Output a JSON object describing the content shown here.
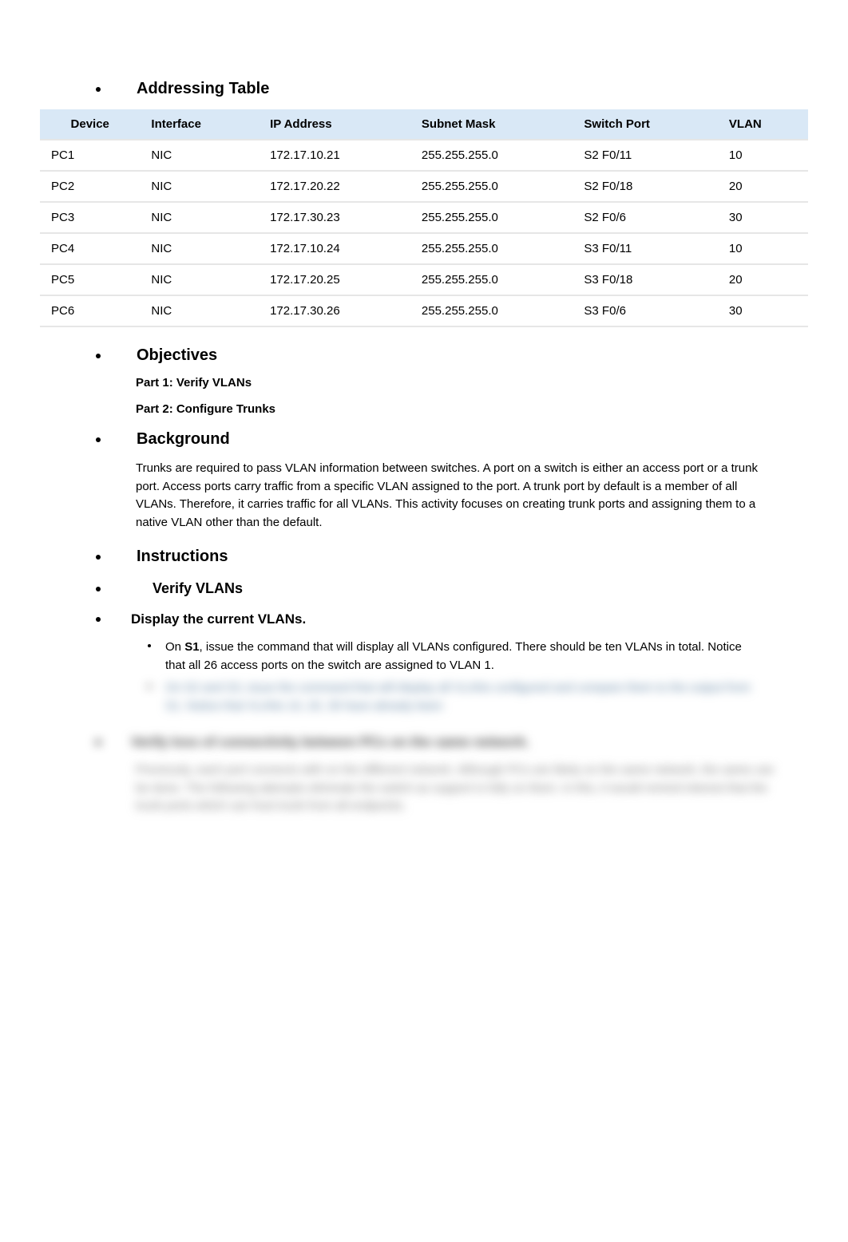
{
  "sections": {
    "addressing_table": "Addressing Table",
    "objectives": "Objectives",
    "background": "Background",
    "instructions": "Instructions",
    "verify_vlans": "Verify VLANs",
    "display_current": "Display the current VLANs."
  },
  "table": {
    "headers": {
      "device": "Device",
      "interface": "Interface",
      "ip": "IP Address",
      "mask": "Subnet Mask",
      "port": "Switch Port",
      "vlan": "VLAN"
    },
    "rows": [
      {
        "device": "PC1",
        "interface": "NIC",
        "ip": "172.17.10.21",
        "mask": "255.255.255.0",
        "port": "S2 F0/11",
        "vlan": "10"
      },
      {
        "device": "PC2",
        "interface": "NIC",
        "ip": "172.17.20.22",
        "mask": "255.255.255.0",
        "port": "S2 F0/18",
        "vlan": "20"
      },
      {
        "device": "PC3",
        "interface": "NIC",
        "ip": "172.17.30.23",
        "mask": "255.255.255.0",
        "port": "S2 F0/6",
        "vlan": "30"
      },
      {
        "device": "PC4",
        "interface": "NIC",
        "ip": "172.17.10.24",
        "mask": "255.255.255.0",
        "port": "S3 F0/11",
        "vlan": "10"
      },
      {
        "device": "PC5",
        "interface": "NIC",
        "ip": "172.17.20.25",
        "mask": "255.255.255.0",
        "port": "S3 F0/18",
        "vlan": "20"
      },
      {
        "device": "PC6",
        "interface": "NIC",
        "ip": "172.17.30.26",
        "mask": "255.255.255.0",
        "port": "S3 F0/6",
        "vlan": "30"
      }
    ]
  },
  "objectives": {
    "part1": "Part 1: Verify VLANs",
    "part2": "Part 2: Configure Trunks"
  },
  "background_text": "Trunks are required to pass VLAN information between switches. A port on a switch is either an access port or a trunk port. Access ports carry traffic from a specific VLAN assigned to the port. A trunk port by default is a member of all VLANs. Therefore, it carries traffic for all VLANs. This activity focuses on creating trunk ports and assigning them to a native VLAN other than the default.",
  "list_item_a_pre": "On ",
  "list_item_a_bold": "S1",
  "list_item_a_post": ", issue the command that will display all VLANs configured. There should be ten VLANs in total. Notice that all 26 access ports on the switch are assigned to VLAN 1.",
  "blurred_list_item": "On S2 and S3, issue the command that will display all VLANs configured and compare them to the output from S1. Notice that VLANs 10, 20, 30 have already been",
  "blurred_heading": "Verify loss of connectivity between PCs on the same network.",
  "blurred_para": "Previously, each port connects with on the different network. Although PCs are likely on the same network, the same can be done. The following attempts eliminate the switch as support is fully on them. In this, it would remind interest that the trunk ports which can host trunk from all endpoints."
}
